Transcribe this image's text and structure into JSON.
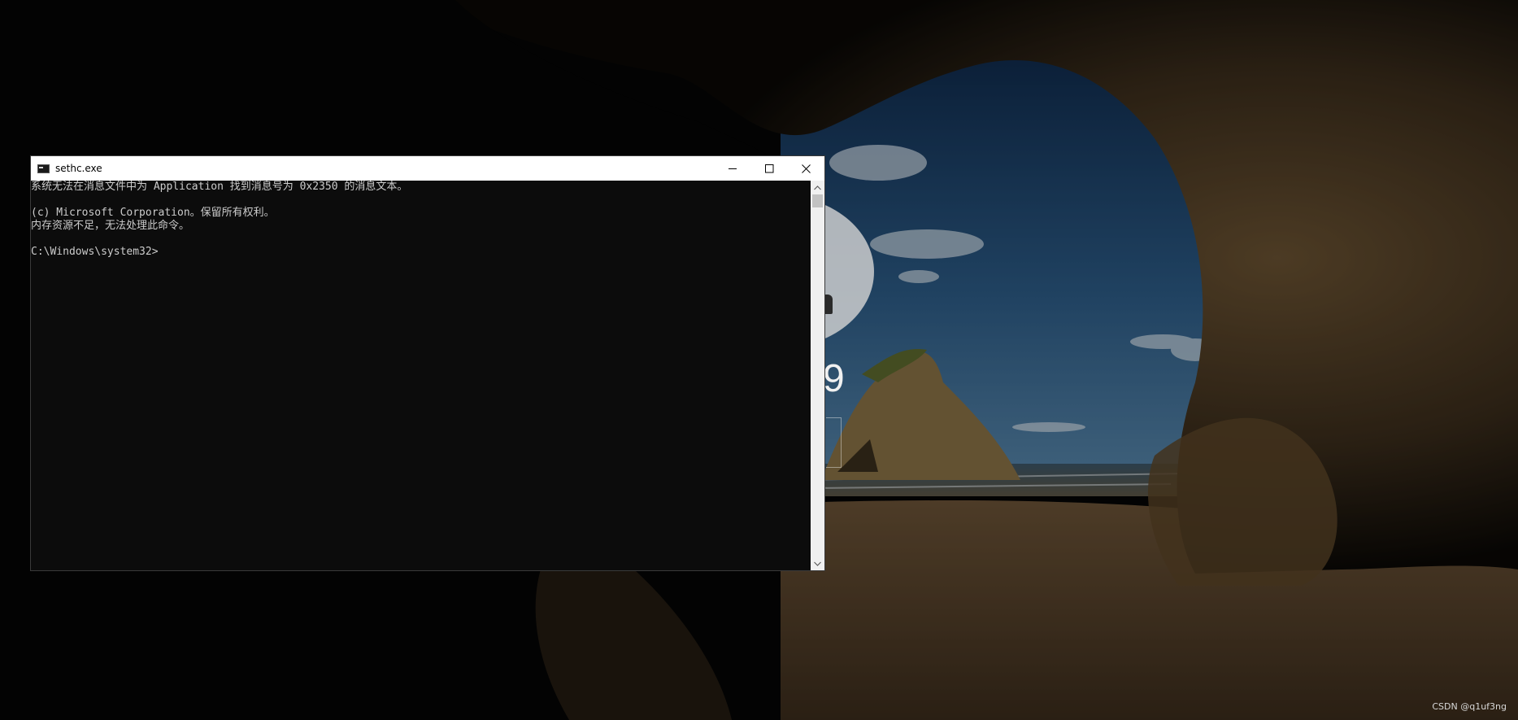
{
  "lock_screen": {
    "time_fragment": "9"
  },
  "window": {
    "title": "sethc.exe",
    "icon": "console-icon",
    "buttons": {
      "minimize_icon": "minimize-icon",
      "maximize_icon": "maximize-icon",
      "close_icon": "close-icon"
    }
  },
  "console": {
    "lines": [
      "系统无法在消息文件中为 Application 找到消息号为 0x2350 的消息文本。",
      "",
      "(c) Microsoft Corporation。保留所有权利。",
      "内存资源不足，无法处理此命令。",
      "",
      "C:\\Windows\\system32>"
    ]
  },
  "watermark": "CSDN @q1uf3ng",
  "colors": {
    "console_bg": "#0c0c0c",
    "console_text": "#cccccc",
    "titlebar_bg": "#ffffff"
  }
}
